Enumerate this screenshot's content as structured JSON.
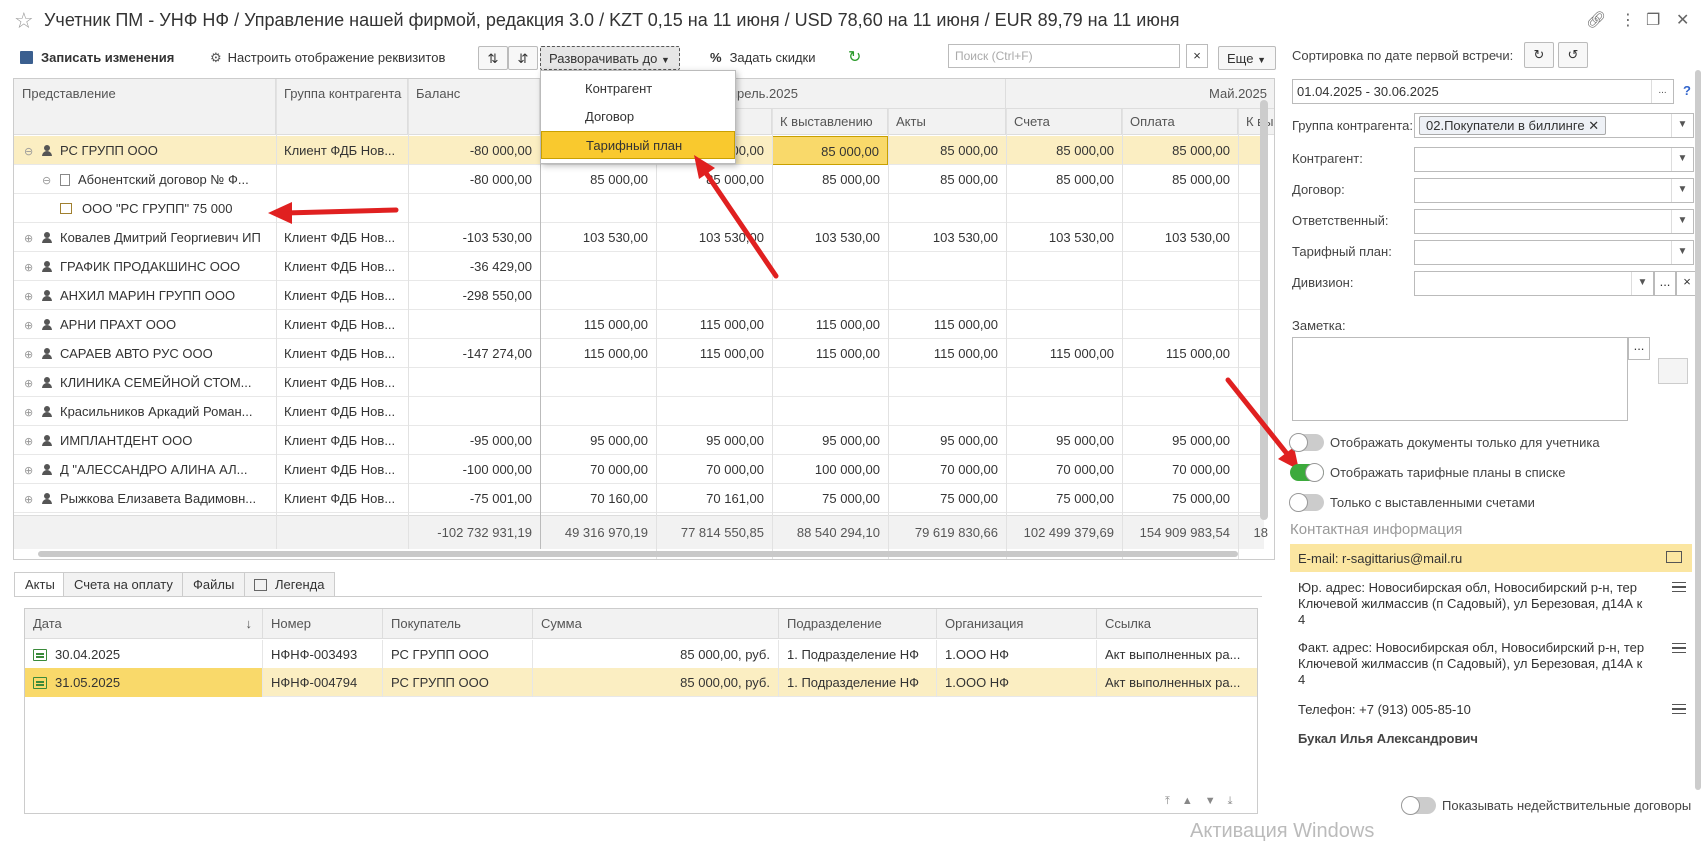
{
  "title": "Учетник ПМ - УНФ НФ / Управление нашей фирмой, редакция 3.0 / KZT 0,15 на 11 июня / USD 78,60 на 11 июня / EUR 89,79 на 11 июня",
  "toolbar": {
    "save_label": "Записать изменения",
    "configure_label": "Настроить отображение реквизитов",
    "expand_label": "Разворачивать до",
    "discounts_label": "Задать скидки",
    "search_placeholder": "Поиск (Ctrl+F)",
    "more_label": "Еще"
  },
  "expand_menu": [
    "Контрагент",
    "Договор",
    "Тарифный план"
  ],
  "grid": {
    "headers": {
      "col1": "Представление",
      "col2": "Группа контрагента",
      "col3": "Баланс",
      "period_april": "прель.2025",
      "period_may": "Май.2025",
      "april_c": "С",
      "sub": [
        "К выставлению",
        "Акты",
        "Счета",
        "Оплата",
        "К вы"
      ]
    },
    "rows": [
      {
        "name": "РС ГРУПП ООО",
        "group": "Клиент ФДБ Нов...",
        "balance": "-80 000,00",
        "v": [
          "",
          "85 000,00",
          "85 000,00",
          "85 000,00",
          "85 000,00",
          "85 000,00"
        ]
      },
      {
        "name": "Абонентский договор № Ф...",
        "group": "",
        "balance": "-80 000,00",
        "v": [
          "85 000,00",
          "85 000,00",
          "85 000,00",
          "85 000,00",
          "85 000,00",
          "85 000,00"
        ]
      },
      {
        "name": "ООО \"РС ГРУПП\" 75 000",
        "group": "",
        "balance": "",
        "v": [
          "",
          "",
          "",
          "",
          "",
          ""
        ]
      },
      {
        "name": "Ковалев Дмитрий Георгиевич ИП",
        "group": "Клиент ФДБ Нов...",
        "balance": "-103 530,00",
        "v": [
          "103 530,00",
          "103 530,00",
          "103 530,00",
          "103 530,00",
          "103 530,00",
          "103 530,00"
        ]
      },
      {
        "name": "ГРАФИК ПРОДАКШИНС ООО",
        "group": "Клиент ФДБ Нов...",
        "balance": "-36 429,00",
        "v": [
          "",
          "",
          "",
          "",
          "",
          ""
        ]
      },
      {
        "name": "АНХИЛ МАРИН ГРУПП ООО",
        "group": "Клиент ФДБ Нов...",
        "balance": "-298 550,00",
        "v": [
          "",
          "",
          "",
          "",
          "",
          ""
        ]
      },
      {
        "name": "АРНИ ПРАХТ ООО",
        "group": "Клиент ФДБ Нов...",
        "balance": "",
        "v": [
          "115 000,00",
          "115 000,00",
          "115 000,00",
          "115 000,00",
          "",
          ""
        ]
      },
      {
        "name": "САРАЕВ АВТО РУС ООО",
        "group": "Клиент ФДБ Нов...",
        "balance": "-147 274,00",
        "v": [
          "115 000,00",
          "115 000,00",
          "115 000,00",
          "115 000,00",
          "115 000,00",
          "115 000,00"
        ]
      },
      {
        "name": "КЛИНИКА СЕМЕЙНОЙ СТОМ...",
        "group": "Клиент ФДБ Нов...",
        "balance": "",
        "v": [
          "",
          "",
          "",
          "",
          "",
          ""
        ]
      },
      {
        "name": "Красильников Аркадий Роман...",
        "group": "Клиент ФДБ Нов...",
        "balance": "",
        "v": [
          "",
          "",
          "",
          "",
          "",
          ""
        ]
      },
      {
        "name": "ИМПЛАНТДЕНТ ООО",
        "group": "Клиент ФДБ Нов...",
        "balance": "-95 000,00",
        "v": [
          "95 000,00",
          "95 000,00",
          "95 000,00",
          "95 000,00",
          "95 000,00",
          "95 000,00"
        ]
      },
      {
        "name": "Д \"АЛЕССАНДРО АЛИНА АЛ...",
        "group": "Клиент ФДБ Нов...",
        "balance": "-100 000,00",
        "v": [
          "70 000,00",
          "70 000,00",
          "100 000,00",
          "70 000,00",
          "70 000,00",
          "70 000,00"
        ]
      },
      {
        "name": "Рыжкова Елизавета Вадимовн...",
        "group": "Клиент ФДБ Нов...",
        "balance": "-75 001,00",
        "v": [
          "70 160,00",
          "70 161,00",
          "75 000,00",
          "75 000,00",
          "75 000,00",
          "75 000,00"
        ]
      }
    ],
    "totals": [
      "-102 732 931,19",
      "49 316 970,19",
      "77 814 550,85",
      "88 540 294,10",
      "79 619 830,66",
      "102 499 379,69",
      "154 909 983,54",
      "18"
    ]
  },
  "tabs": [
    "Акты",
    "Счета на оплату",
    "Файлы",
    "Легенда"
  ],
  "acts": {
    "headers": [
      "Дата",
      "Номер",
      "Покупатель",
      "Сумма",
      "Подразделение",
      "Организация",
      "Ссылка"
    ],
    "rows": [
      [
        "30.04.2025",
        "НФНФ-003493",
        "РС ГРУПП ООО",
        "85 000,00, руб.",
        "1. Подразделение НФ",
        "1.ООО НФ",
        "Акт выполненных ра..."
      ],
      [
        "31.05.2025",
        "НФНФ-004794",
        "РС ГРУПП ООО",
        "85 000,00, руб.",
        "1. Подразделение НФ",
        "1.ООО НФ",
        "Акт выполненных ра..."
      ]
    ]
  },
  "panel": {
    "sort_label": "Сортировка по дате первой встречи:",
    "period": "01.04.2025 - 30.06.2025",
    "help": "?",
    "group_label": "Группа контрагента:",
    "group_value": "02.Покупатели в биллинге",
    "fields": [
      "Контрагент:",
      "Договор:",
      "Ответственный:",
      "Тарифный план:",
      "Дивизион:"
    ],
    "note_label": "Заметка:",
    "toggles": [
      {
        "label": "Отображать документы только для учетника",
        "on": false
      },
      {
        "label": "Отображать тарифные планы в списке",
        "on": true
      },
      {
        "label": "Только с выставленными счетами",
        "on": false
      }
    ],
    "contact_head": "Контактная информация",
    "email": "E-mail: r-sagittarius@mail.ru",
    "legal_address": "Юр. адрес: Новосибирская обл, Новосибирский р-н, тер Ключевой жилмассив (п Садовый), ул Березовая, д14А к 4",
    "actual_address": "Факт. адрес: Новосибирская обл, Новосибирский р-н, тер Ключевой жилмассив (п Садовый), ул Березовая, д14А к 4",
    "phone": "Телефон: +7 (913) 005-85-10",
    "person": "Букал Илья Александрович",
    "invalid_toggle": "Показывать недействительные договоры"
  },
  "watermark": "Активация Windows",
  "colors": {
    "accent": "#f9c92e",
    "selected_row": "#fbeec2",
    "toggle_on": "#3caa3c",
    "arrow": "#e02020"
  }
}
